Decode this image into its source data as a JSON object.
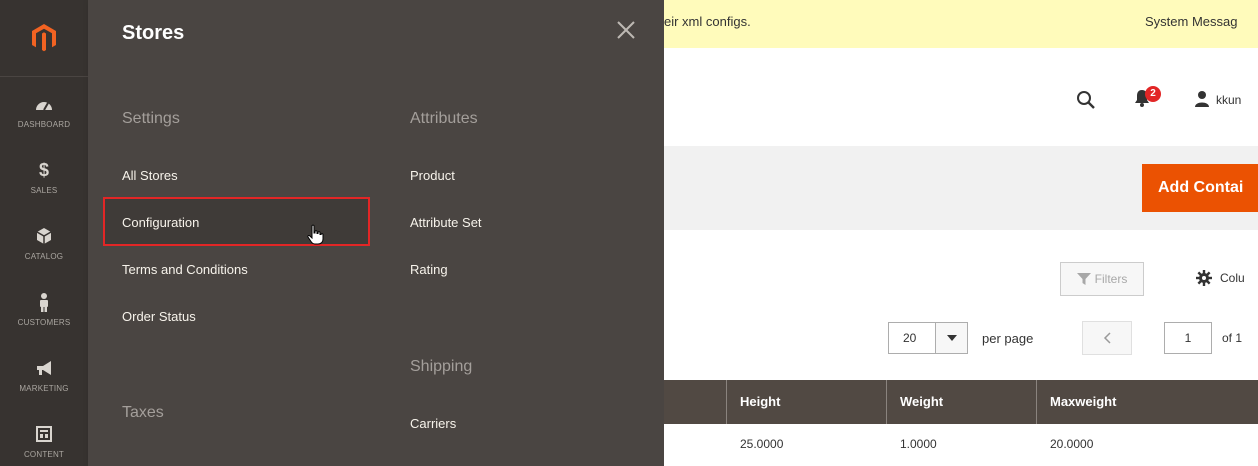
{
  "admin_menu": {
    "items": [
      {
        "label": "DASHBOARD"
      },
      {
        "label": "SALES",
        "glyph": "$"
      },
      {
        "label": "CATALOG"
      },
      {
        "label": "CUSTOMERS"
      },
      {
        "label": "MARKETING"
      },
      {
        "label": "CONTENT"
      }
    ]
  },
  "flyout": {
    "title": "Stores",
    "sections": {
      "settings": {
        "heading": "Settings",
        "items": [
          "All Stores",
          "Configuration",
          "Terms and Conditions",
          "Order Status"
        ]
      },
      "taxes": {
        "heading": "Taxes"
      },
      "attributes": {
        "heading": "Attributes",
        "items": [
          "Product",
          "Attribute Set",
          "Rating"
        ]
      },
      "shipping": {
        "heading": "Shipping",
        "items": [
          "Carriers"
        ]
      }
    }
  },
  "system_bar": {
    "text": "eir xml configs.",
    "link": "System Messag"
  },
  "header": {
    "notification_count": "2",
    "username": "kkun"
  },
  "action": {
    "add_label": "Add Contai"
  },
  "grid_controls": {
    "filters_label": "Filters",
    "columns_label": "Colu",
    "per_page_value": "20",
    "per_page_label": "per page",
    "page_value": "1",
    "page_of": "of 1"
  },
  "grid": {
    "columns": [
      "Height",
      "Weight",
      "Maxweight"
    ],
    "rows": [
      [
        "25.0000",
        "1.0000",
        "20.0000"
      ]
    ]
  },
  "colors": {
    "menu_bg": "#373330",
    "flyout_bg": "#4a4542",
    "accent": "#eb5202",
    "highlight_border": "#e22626",
    "grid_header_bg": "#514943",
    "message_bg": "#fffbbb"
  }
}
